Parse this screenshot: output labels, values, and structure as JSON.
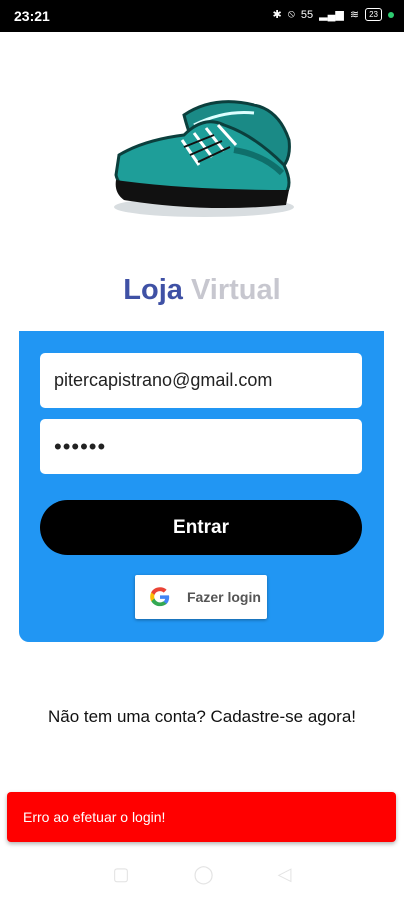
{
  "status": {
    "time": "23:21",
    "battery": "23",
    "signal_label": "55"
  },
  "brand": {
    "part1": "Loja",
    "part2": "Virtual"
  },
  "form": {
    "email_value": "pitercapistrano@gmail.com",
    "password_value": "••••••",
    "submit_label": "Entrar",
    "google_label": "Fazer login"
  },
  "signup_text": "Não tem uma conta? Cadastre-se agora!",
  "toast_text": "Erro ao efetuar o login!",
  "colors": {
    "card": "#2196f3",
    "brand_primary": "#3f51a5",
    "brand_secondary": "#c7c7cf",
    "toast": "#ff0000"
  }
}
